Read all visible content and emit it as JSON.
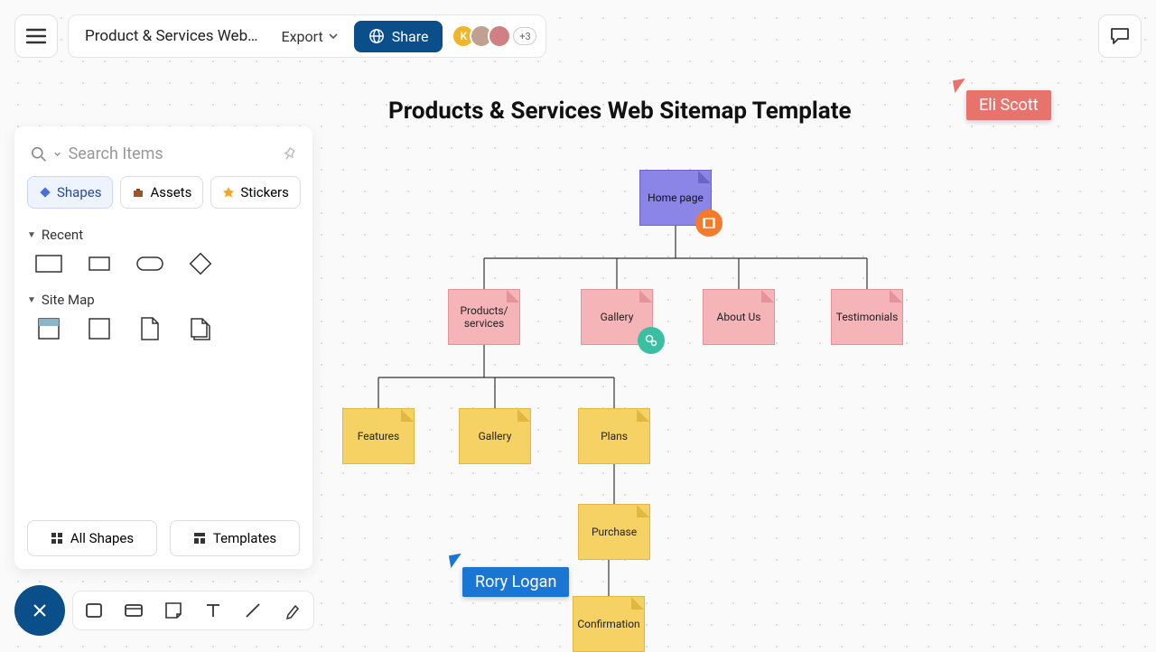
{
  "header": {
    "doc_title": "Product & Services Web…",
    "export_label": "Export",
    "share_label": "Share",
    "avatar_more": "+3"
  },
  "panel": {
    "search_placeholder": "Search Items",
    "tabs": {
      "shapes": "Shapes",
      "assets": "Assets",
      "stickers": "Stickers"
    },
    "sections": {
      "recent": "Recent",
      "sitemap": "Site Map"
    },
    "footer": {
      "all_shapes": "All Shapes",
      "templates": "Templates"
    }
  },
  "canvas": {
    "title": "Products & Services Web Sitemap Template",
    "nodes": {
      "home": "Home page",
      "products": "Products/\nservices",
      "gallery1": "Gallery",
      "about": "About Us",
      "testimonials": "Testimonials",
      "features": "Features",
      "gallery2": "Gallery",
      "plans": "Plans",
      "purchase": "Purchase",
      "confirmation": "Confirmation"
    }
  },
  "cursors": {
    "eli": "Eli Scott",
    "rory": "Rory Logan"
  }
}
